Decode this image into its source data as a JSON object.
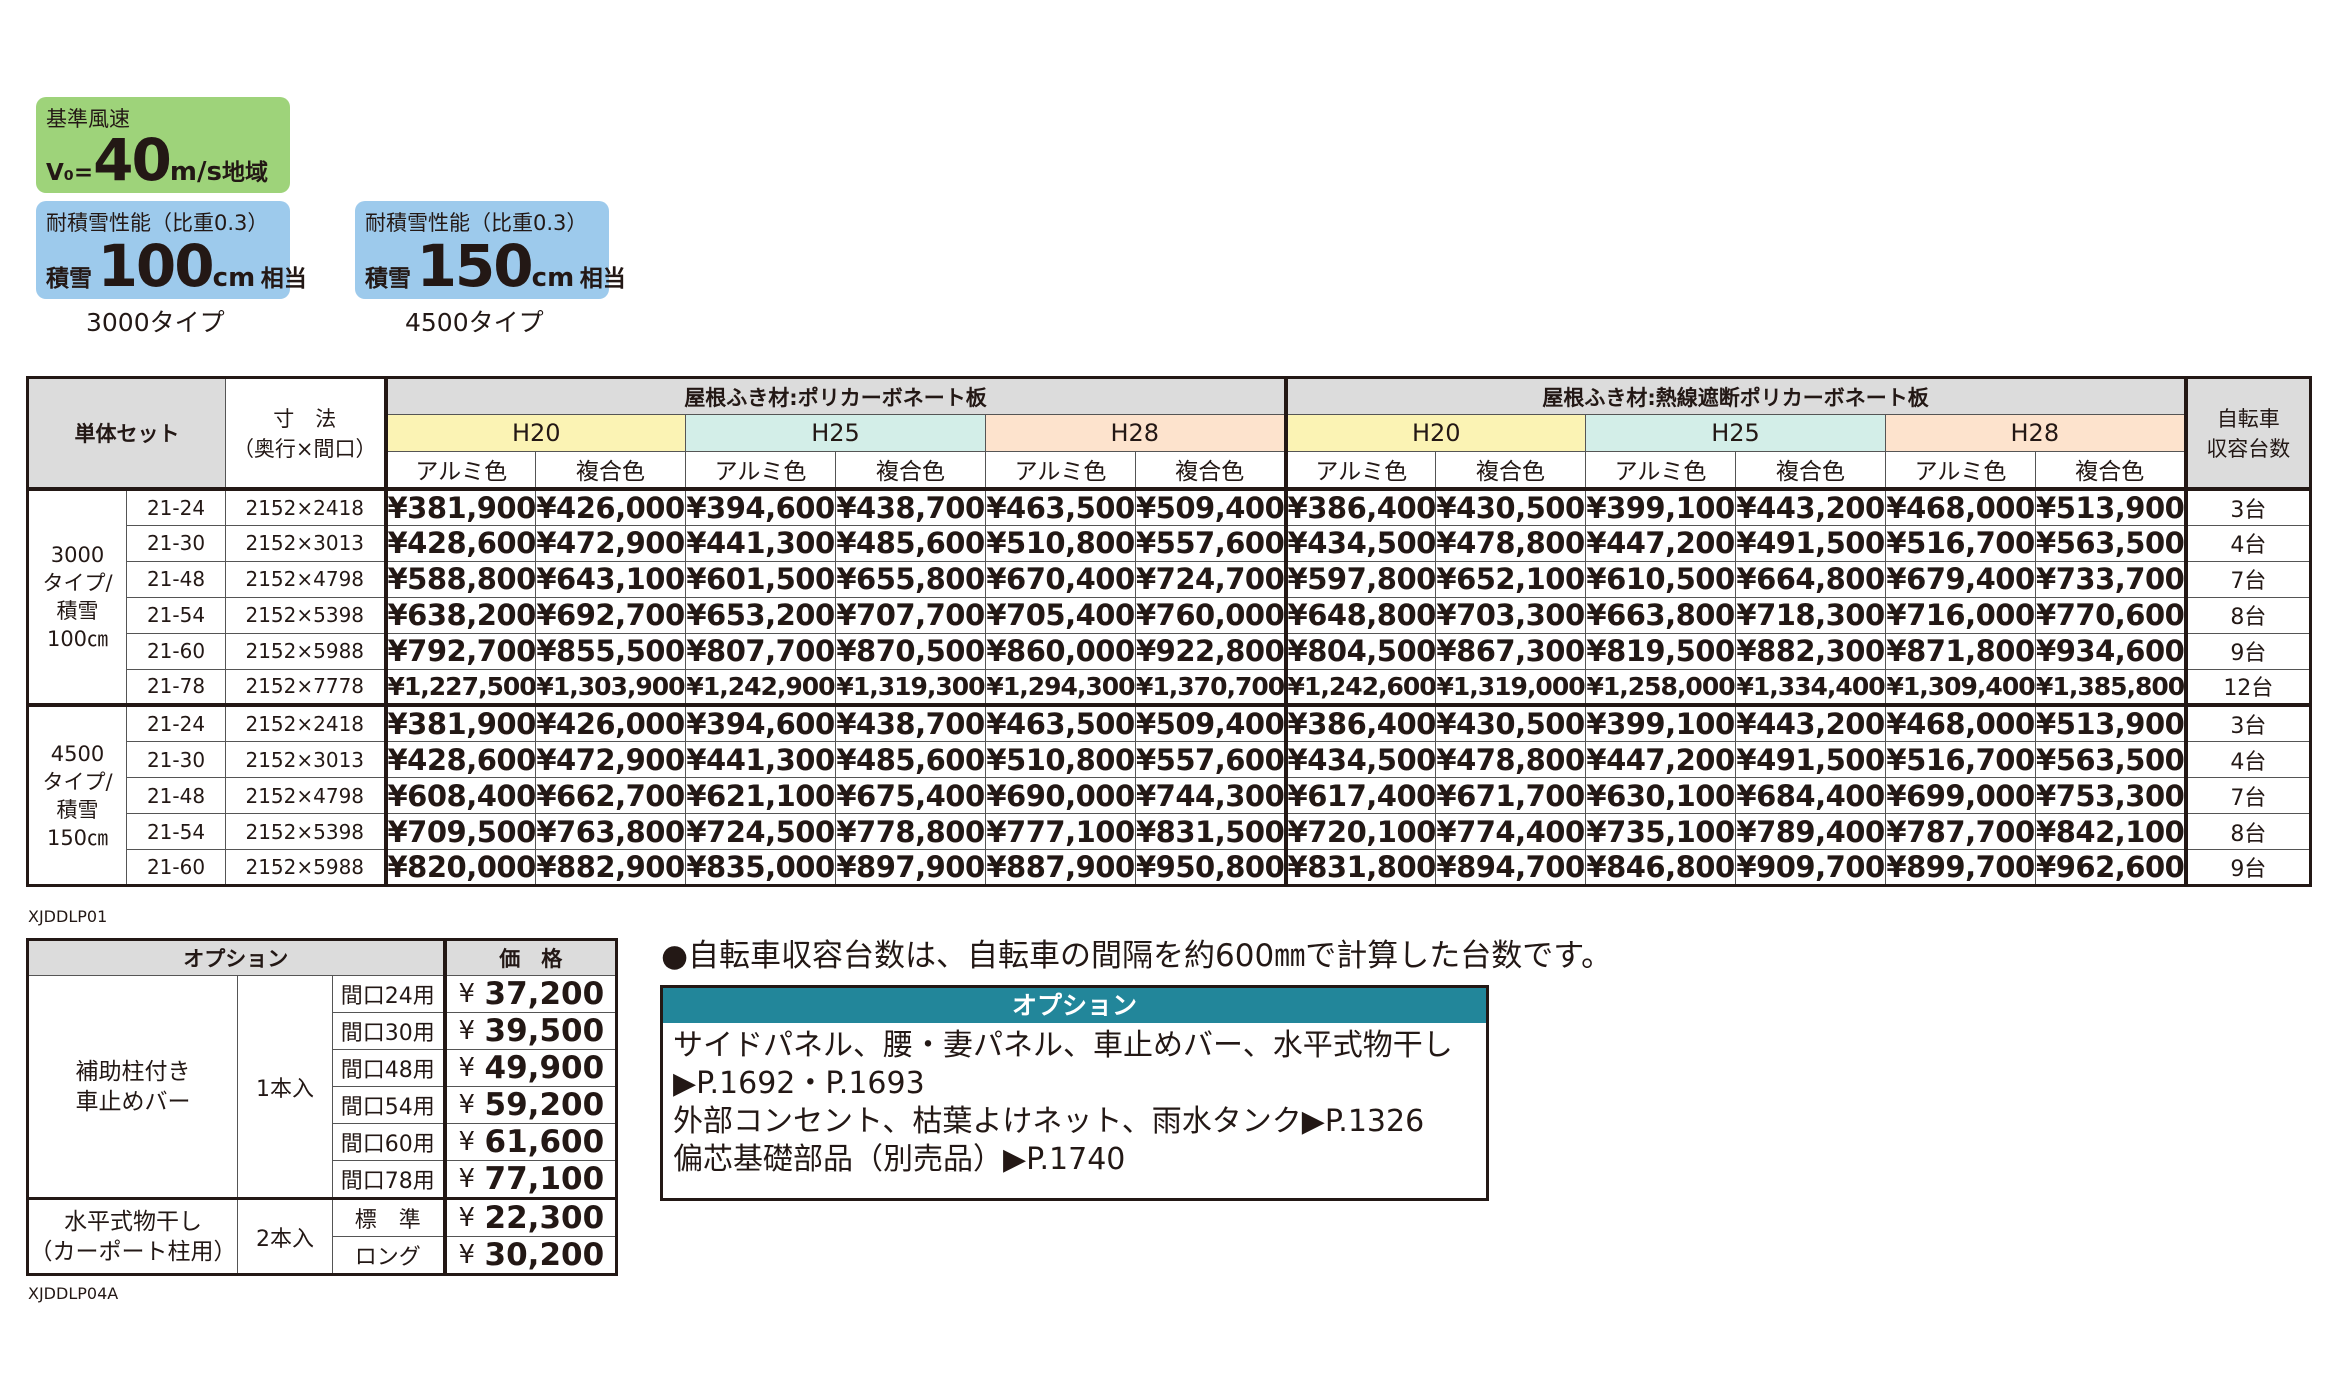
{
  "badges": {
    "wind_title": "基準風速",
    "wind_v": "V₀=",
    "wind_value": "40",
    "wind_unit": "m/s",
    "wind_suffix": "地域",
    "snow_title": "耐積雪性能（比重0.3）",
    "snow_prefix": "積雪",
    "snow_unit": "cm",
    "snow_suffix": "相当",
    "snow1_value": "100",
    "snow2_value": "150",
    "type1_label": "3000タイプ",
    "type2_label": "4500タイプ"
  },
  "main_table": {
    "header_set": "単体セット",
    "header_dim": "寸　法\n（奥行×間口）",
    "roof1": "屋根ふき材:ポリカーボネート板",
    "roof2": "屋根ふき材:熱線遮断ポリカーボネート板",
    "capacity_header": "自転車\n収容台数",
    "heights": [
      "H20",
      "H25",
      "H28",
      "H20",
      "H25",
      "H28"
    ],
    "colors": [
      "アルミ色",
      "複合色",
      "アルミ色",
      "複合色",
      "アルミ色",
      "複合色",
      "アルミ色",
      "複合色",
      "アルミ色",
      "複合色",
      "アルミ色",
      "複合色"
    ],
    "groups": [
      {
        "label": "3000\nタイプ/\n積雪\n100㎝",
        "rows": [
          {
            "code": "21-24",
            "dim": "2152×2418",
            "prices": [
              "¥381,900",
              "¥426,000",
              "¥394,600",
              "¥438,700",
              "¥463,500",
              "¥509,400",
              "¥386,400",
              "¥430,500",
              "¥399,100",
              "¥443,200",
              "¥468,000",
              "¥513,900"
            ],
            "capacity": "3台"
          },
          {
            "code": "21-30",
            "dim": "2152×3013",
            "prices": [
              "¥428,600",
              "¥472,900",
              "¥441,300",
              "¥485,600",
              "¥510,800",
              "¥557,600",
              "¥434,500",
              "¥478,800",
              "¥447,200",
              "¥491,500",
              "¥516,700",
              "¥563,500"
            ],
            "capacity": "4台"
          },
          {
            "code": "21-48",
            "dim": "2152×4798",
            "prices": [
              "¥588,800",
              "¥643,100",
              "¥601,500",
              "¥655,800",
              "¥670,400",
              "¥724,700",
              "¥597,800",
              "¥652,100",
              "¥610,500",
              "¥664,800",
              "¥679,400",
              "¥733,700"
            ],
            "capacity": "7台"
          },
          {
            "code": "21-54",
            "dim": "2152×5398",
            "prices": [
              "¥638,200",
              "¥692,700",
              "¥653,200",
              "¥707,700",
              "¥705,400",
              "¥760,000",
              "¥648,800",
              "¥703,300",
              "¥663,800",
              "¥718,300",
              "¥716,000",
              "¥770,600"
            ],
            "capacity": "8台"
          },
          {
            "code": "21-60",
            "dim": "2152×5988",
            "prices": [
              "¥792,700",
              "¥855,500",
              "¥807,700",
              "¥870,500",
              "¥860,000",
              "¥922,800",
              "¥804,500",
              "¥867,300",
              "¥819,500",
              "¥882,300",
              "¥871,800",
              "¥934,600"
            ],
            "capacity": "9台"
          },
          {
            "code": "21-78",
            "dim": "2152×7778",
            "prices": [
              "¥1,227,500",
              "¥1,303,900",
              "¥1,242,900",
              "¥1,319,300",
              "¥1,294,300",
              "¥1,370,700",
              "¥1,242,600",
              "¥1,319,000",
              "¥1,258,000",
              "¥1,334,400",
              "¥1,309,400",
              "¥1,385,800"
            ],
            "capacity": "12台"
          }
        ]
      },
      {
        "label": "4500\nタイプ/\n積雪\n150㎝",
        "rows": [
          {
            "code": "21-24",
            "dim": "2152×2418",
            "prices": [
              "¥381,900",
              "¥426,000",
              "¥394,600",
              "¥438,700",
              "¥463,500",
              "¥509,400",
              "¥386,400",
              "¥430,500",
              "¥399,100",
              "¥443,200",
              "¥468,000",
              "¥513,900"
            ],
            "capacity": "3台"
          },
          {
            "code": "21-30",
            "dim": "2152×3013",
            "prices": [
              "¥428,600",
              "¥472,900",
              "¥441,300",
              "¥485,600",
              "¥510,800",
              "¥557,600",
              "¥434,500",
              "¥478,800",
              "¥447,200",
              "¥491,500",
              "¥516,700",
              "¥563,500"
            ],
            "capacity": "4台"
          },
          {
            "code": "21-48",
            "dim": "2152×4798",
            "prices": [
              "¥608,400",
              "¥662,700",
              "¥621,100",
              "¥675,400",
              "¥690,000",
              "¥744,300",
              "¥617,400",
              "¥671,700",
              "¥630,100",
              "¥684,400",
              "¥699,000",
              "¥753,300"
            ],
            "capacity": "7台"
          },
          {
            "code": "21-54",
            "dim": "2152×5398",
            "prices": [
              "¥709,500",
              "¥763,800",
              "¥724,500",
              "¥778,800",
              "¥777,100",
              "¥831,500",
              "¥720,100",
              "¥774,400",
              "¥735,100",
              "¥789,400",
              "¥787,700",
              "¥842,100"
            ],
            "capacity": "8台"
          },
          {
            "code": "21-60",
            "dim": "2152×5988",
            "prices": [
              "¥820,000",
              "¥882,900",
              "¥835,000",
              "¥897,900",
              "¥887,900",
              "¥950,800",
              "¥831,800",
              "¥894,700",
              "¥846,800",
              "¥909,700",
              "¥899,700",
              "¥962,600"
            ],
            "capacity": "9台"
          }
        ]
      }
    ],
    "code_label": "XJDDLP01"
  },
  "option_table": {
    "header_option": "オプション",
    "header_price": "価　格",
    "yen": "¥",
    "items": [
      {
        "name": "補助柱付き\n車止めバー",
        "count": "1本入",
        "sizes": [
          {
            "size": "間口24用",
            "price": "37,200"
          },
          {
            "size": "間口30用",
            "price": "39,500"
          },
          {
            "size": "間口48用",
            "price": "49,900"
          },
          {
            "size": "間口54用",
            "price": "59,200"
          },
          {
            "size": "間口60用",
            "price": "61,600"
          },
          {
            "size": "間口78用",
            "price": "77,100"
          }
        ]
      },
      {
        "name": "水平式物干し\n（カーポート柱用）",
        "count": "2本入",
        "sizes": [
          {
            "size": "標　準",
            "price": "22,300"
          },
          {
            "size": "ロング",
            "price": "30,200"
          }
        ]
      }
    ],
    "code_label": "XJDDLP04A"
  },
  "note": "●自転車収容台数は、自転車の間隔を約600㎜で計算した台数です。",
  "option_box": {
    "title": "オプション",
    "lines": [
      "サイドパネル、腰・妻パネル、車止めバー、水平式物干し",
      "▶P.1692・P.1693",
      "外部コンセント、枯葉よけネット、雨水タンク▶P.1326",
      "偏芯基礎部品（別売品）▶P.1740"
    ]
  },
  "colors": {
    "wind_badge": "#9ed37a",
    "snow_badge": "#9dcaec",
    "h20": "#fbf3b4",
    "h25": "#d3eee8",
    "h28": "#fde3cd",
    "header_gray": "#dcdcdc",
    "option_title": "#22869a"
  }
}
